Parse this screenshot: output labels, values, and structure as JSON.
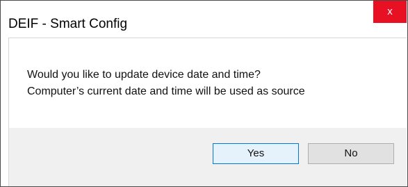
{
  "window": {
    "title": "DEIF - Smart Config",
    "close_glyph": "x",
    "close_color": "#e81123"
  },
  "message": {
    "line1": "Would you like to update device date and time?",
    "line2": "Computer’s current date and time will be used as source"
  },
  "buttons": {
    "yes_label": "Yes",
    "no_label": "No",
    "default_border_color": "#0078d7"
  }
}
